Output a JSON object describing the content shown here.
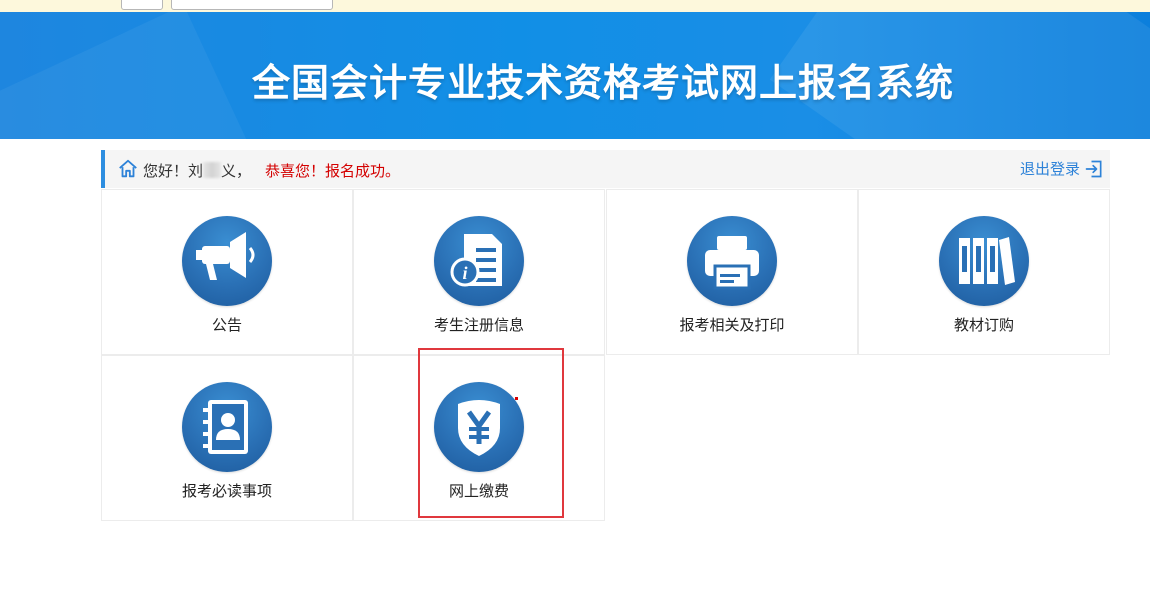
{
  "banner": {
    "title": "全国会计专业技术资格考试网上报名系统"
  },
  "welcome": {
    "greeting": "您好！",
    "user_name_start": "刘",
    "user_name_end": "义，",
    "success_message": "恭喜您！报名成功。"
  },
  "logout": {
    "label": "退出登录",
    "icon": "logout-icon"
  },
  "menu": [
    {
      "label": "公告",
      "icon": "megaphone-icon"
    },
    {
      "label": "考生注册信息",
      "icon": "document-info-icon"
    },
    {
      "label": "报考相关及打印",
      "icon": "printer-icon"
    },
    {
      "label": "教材订购",
      "icon": "books-icon"
    },
    {
      "label": "报考必读事项",
      "icon": "contact-book-icon"
    },
    {
      "label": "网上缴费",
      "icon": "yuan-shield-icon"
    }
  ],
  "colors": {
    "banner": "#118fe6",
    "accent": "#2d8ee0",
    "success": "#d40000",
    "icon_circle": "#2a70b5",
    "highlight": "#e0383d"
  }
}
